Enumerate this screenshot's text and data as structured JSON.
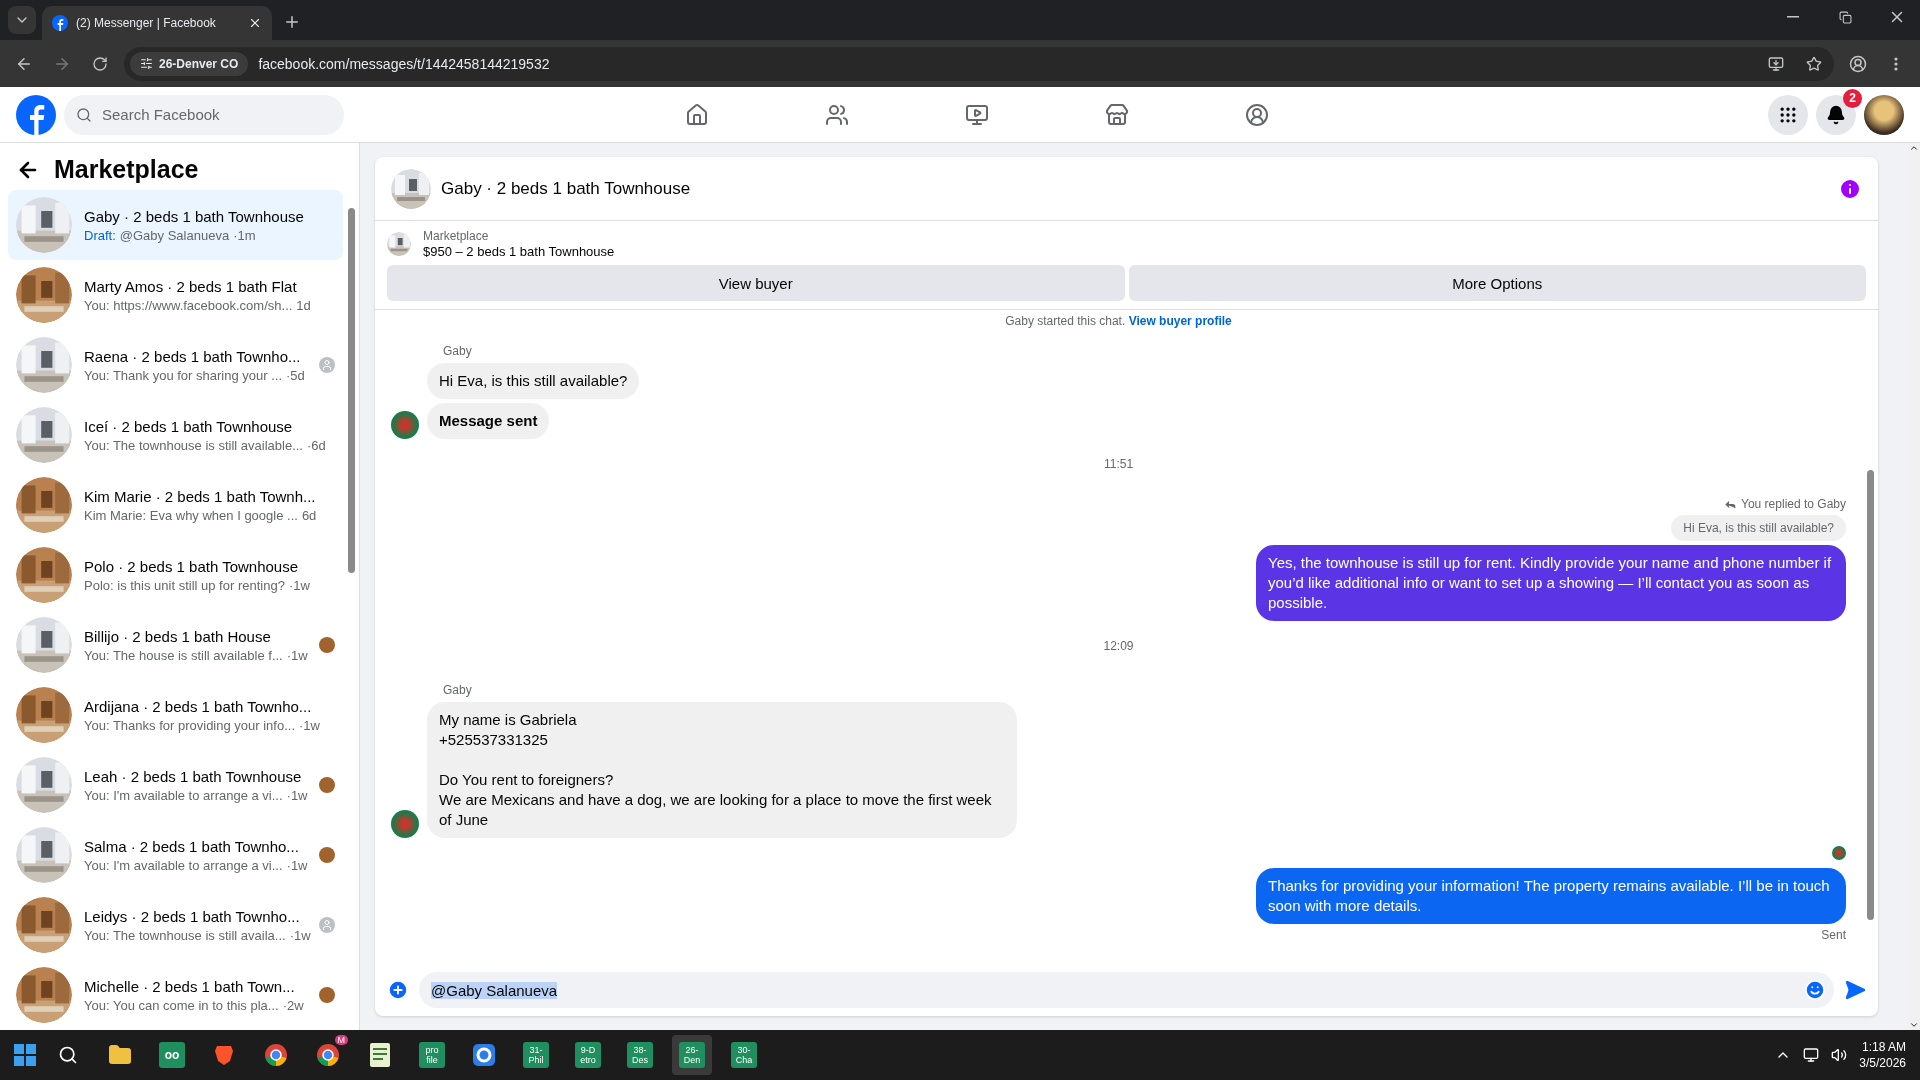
{
  "browser": {
    "tab_title": "(2) Messenger | Facebook",
    "site_chip": "26-Denver CO",
    "url": "facebook.com/messages/t/1442458144219532"
  },
  "header": {
    "search_placeholder": "Search Facebook",
    "notification_count": "2"
  },
  "sidebar": {
    "title": "Marketplace",
    "items": [
      {
        "name": "Gaby · 2 beds 1 bath Townhouse",
        "draft_label": "Draft:",
        "preview": "@Gaby Salanueva",
        "time": "·1m",
        "selected": true
      },
      {
        "name": "Marty Amos · 2 beds 1 bath Flat",
        "preview": "You: https://www.facebook.com/sh...",
        "time": "1d",
        "selected": false
      },
      {
        "name": "Raena · 2 beds 1 bath Townho...",
        "preview": "You: Thank you for sharing your ...",
        "time": "·5d",
        "selected": false,
        "seen_by": {
          "kind": "placeholder"
        }
      },
      {
        "name": "Iceí · 2 beds 1 bath Townhouse",
        "preview": "You: The townhouse is still available...",
        "time": "·6d",
        "selected": false
      },
      {
        "name": "Kim Marie · 2 beds 1 bath Townh...",
        "preview": "Kim Marie: Eva why when I google ...",
        "time": "6d",
        "selected": false
      },
      {
        "name": "Polo · 2 beds 1 bath Townhouse",
        "preview": "Polo: is this unit still up for renting?",
        "time": "·1w",
        "selected": false
      },
      {
        "name": "Billijo · 2 beds 1 bath House",
        "preview": "You: The house is still available f...",
        "time": "·1w",
        "selected": false
      },
      {
        "name": "Ardijana · 2 beds 1 bath Townho...",
        "preview": "You: Thanks for providing your info...",
        "time": "·1w",
        "selected": false
      },
      {
        "name": "Leah · 2 beds 1 bath Townhouse",
        "preview": "You: I'm available to arrange a vi...",
        "time": "·1w",
        "selected": false
      },
      {
        "name": "Salma · 2 beds 1 bath Townho...",
        "preview": "You: I'm available to arrange a vi...",
        "time": "·1w",
        "selected": false
      },
      {
        "name": "Leidys · 2 beds 1 bath Townho...",
        "preview": "You: The townhouse is still availa...",
        "time": "·1w",
        "selected": false,
        "seen_by": {
          "kind": "placeholder"
        }
      },
      {
        "name": "Michelle · 2 beds 1 bath Town...",
        "preview": "You: You can come in to this pla...",
        "time": "·2w",
        "selected": false
      }
    ]
  },
  "chat": {
    "title": "Gaby · 2 beds 1 bath Townhouse",
    "listing_source": "Marketplace",
    "listing_title": "$950 – 2 beds 1 bath Townhouse",
    "buttons": [
      "View buyer",
      "More Options"
    ],
    "messages": [
      {
        "kind": "system",
        "text": "Gaby started this chat.",
        "link": "View buyer profile"
      },
      {
        "kind": "incoming",
        "sender": "Gaby",
        "bubbles": [
          {
            "text": "Hi Eva, is this still available?",
            "bold": false
          },
          {
            "text": "Message sent",
            "bold": true
          }
        ]
      },
      {
        "kind": "time",
        "text": "11:51"
      },
      {
        "kind": "outgoing",
        "reply_label": "You replied to Gaby",
        "quoted": "Hi Eva, is this still available?",
        "text": "Yes, the townhouse is still up for rent. Kindly provide your name and phone number if you’d like additional info or want to set up a showing — I’ll contact you as soon as possible.",
        "color": "#5b34e6"
      },
      {
        "kind": "time",
        "text": "12:09"
      },
      {
        "kind": "incoming",
        "sender": "Gaby",
        "bubbles": [
          {
            "text": "My name is Gabriela\n+525537331325\n\nDo You rent to foreigners?\nWe are Mexicans and have a dog, we are looking for a place to move the first week of June",
            "bold": false
          }
        ]
      },
      {
        "kind": "receipt"
      },
      {
        "kind": "outgoing",
        "text": "Thanks for providing your information! The property remains available. I’ll be in touch soon with more details.",
        "color": "#0b66f2",
        "status": "Sent"
      }
    ],
    "composer_value": "@Gaby Salanueva"
  },
  "taskbar": {
    "apps": [
      {
        "kind": "files",
        "selected": false
      },
      {
        "kind": "glyph",
        "label": "oo",
        "selected": false
      },
      {
        "kind": "brave",
        "selected": false
      },
      {
        "kind": "chrome",
        "selected": false
      },
      {
        "kind": "chrome",
        "badge": "M",
        "selected": false
      },
      {
        "kind": "sheet",
        "selected": false
      },
      {
        "kind": "tile",
        "label": "pro\nfile",
        "selected": false
      },
      {
        "kind": "ring",
        "selected": false
      },
      {
        "kind": "tile",
        "label": "31-\nPhil",
        "selected": false
      },
      {
        "kind": "tile",
        "label": "9-D\netro",
        "selected": false
      },
      {
        "kind": "tile",
        "label": "38-\nDes",
        "selected": false
      },
      {
        "kind": "tile",
        "label": "26-\nDen",
        "selected": true
      },
      {
        "kind": "tile",
        "label": "30-\nCha",
        "selected": false
      }
    ],
    "time": "1:18 AM",
    "date": "3/5/2026"
  }
}
